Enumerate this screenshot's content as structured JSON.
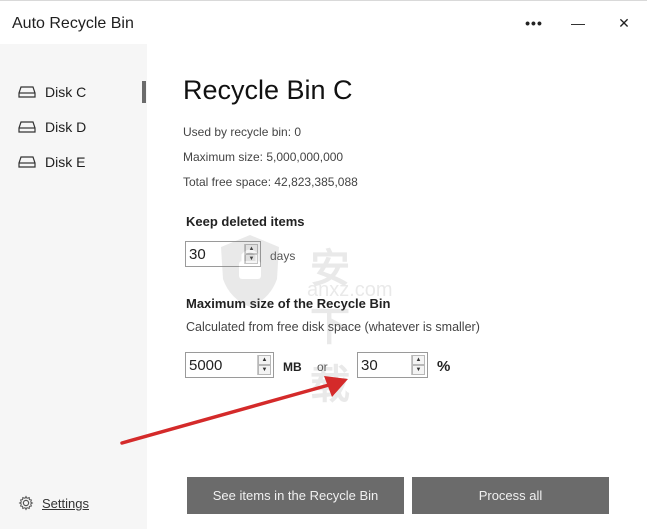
{
  "window": {
    "title": "Auto Recycle Bin",
    "more_label": "•••",
    "minimize_label": "—",
    "close_label": "✕"
  },
  "sidebar": {
    "items": [
      {
        "label": "Disk C",
        "icon": "disk-icon",
        "selected": true
      },
      {
        "label": "Disk D",
        "icon": "disk-icon",
        "selected": false
      },
      {
        "label": "Disk E",
        "icon": "disk-icon",
        "selected": false
      }
    ],
    "settings_label": "Settings",
    "settings_icon": "gear-icon"
  },
  "main": {
    "title": "Recycle Bin C",
    "used": "Used by recycle bin: 0",
    "max_size": "Maximum size: 5,000,000,000",
    "free_space": "Total free space: 42,823,385,088",
    "keep": {
      "heading": "Keep deleted items",
      "value": "30",
      "unit": "days"
    },
    "max_section": {
      "heading": "Maximum size of the Recycle Bin",
      "subtitle": "Calculated from free disk space (whatever is smaller)",
      "mb_value": "5000",
      "mb_unit": "MB",
      "or_label": "or",
      "percent_value": "30",
      "percent_unit": "%"
    }
  },
  "buttons": {
    "see_items": "See items in the Recycle Bin",
    "process_all": "Process all"
  },
  "watermark": {
    "text": "安下载",
    "sub": "anxz.com"
  },
  "colors": {
    "button_bg": "#6b6b6b",
    "sidebar_bg": "#f6f6f6",
    "arrow": "#d42a2a"
  }
}
